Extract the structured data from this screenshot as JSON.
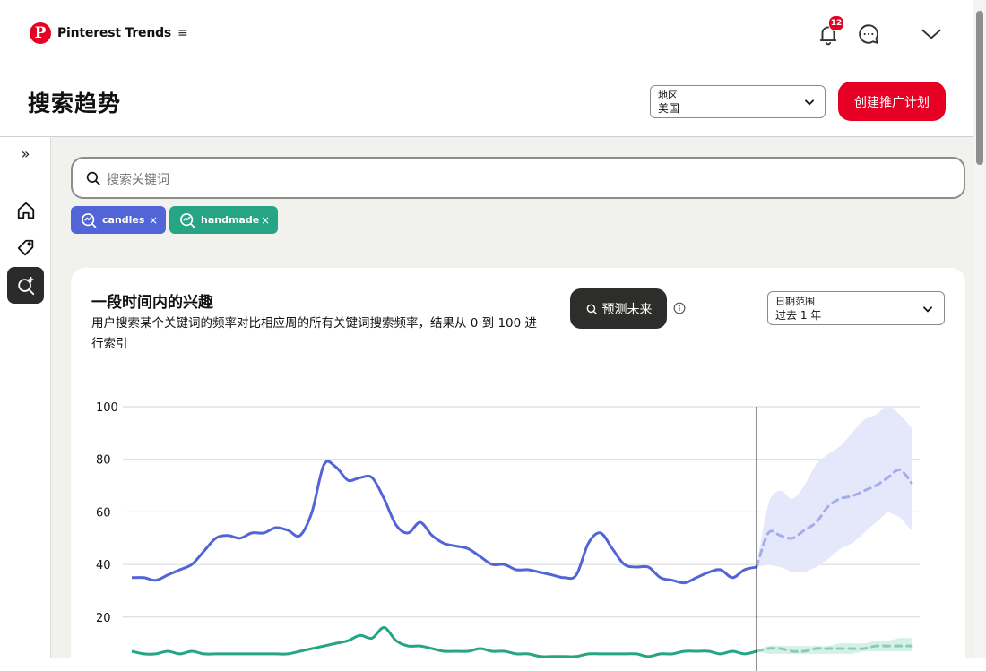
{
  "app": {
    "brand_name": "Pinterest Trends",
    "brand_letter": "P",
    "menu_glyph": "≡",
    "notifications_count": "12"
  },
  "colors": {
    "brand": "#e60023",
    "candles": "#5265d6",
    "handmade": "#26a585",
    "forecast_band": "#e4e7fb"
  },
  "icons": {
    "bell": "bell-icon",
    "chat": "chat-bubble-icon",
    "chevron": "chevron-down-icon",
    "home": "home-icon",
    "tag": "tag-icon",
    "trends": "trend-search-icon"
  },
  "header": {
    "title": "搜索趋势",
    "region_label": "地区",
    "region_value": "美国",
    "create_button": "创建推广计划"
  },
  "sidebar": {
    "expand_glyph": "»"
  },
  "search": {
    "placeholder": "搜索关键词"
  },
  "chips": [
    {
      "label": "candles",
      "remove": "×"
    },
    {
      "label": "handmade",
      "remove": "×"
    }
  ],
  "card": {
    "title": "一段时间内的兴趣",
    "subtitle": "用户搜索某个关键词的频率对比相应周的所有关键词搜索频率，结果从 0 到 100 进行索引",
    "forecast_button": "预测未来",
    "date_label": "日期范围",
    "date_value": "过去 1 年"
  },
  "chart_data": {
    "type": "line",
    "ylim": [
      0,
      100
    ],
    "yticks": [
      20,
      40,
      60,
      80,
      100
    ],
    "grid": true,
    "series": [
      {
        "name": "candles",
        "color": "#5265d6",
        "values": [
          35,
          35,
          34,
          36,
          38,
          40,
          45,
          50,
          51,
          50,
          52,
          52,
          54,
          53,
          51,
          60,
          78,
          77,
          72,
          73,
          73,
          65,
          55,
          52,
          56,
          51,
          48,
          47,
          46,
          43,
          40,
          40,
          38,
          38,
          37,
          36,
          35,
          36,
          48,
          52,
          46,
          40,
          39,
          39,
          35,
          34,
          33,
          35,
          37,
          38,
          35,
          38,
          39
        ],
        "forecast": [
          52,
          51,
          50,
          53,
          56,
          62,
          65,
          66,
          68,
          70,
          73,
          76,
          71
        ],
        "forecast_upper": [
          63,
          68,
          65,
          70,
          78,
          82,
          85,
          90,
          95,
          97,
          100,
          97,
          92
        ],
        "forecast_lower": [
          40,
          39,
          37,
          37,
          39,
          42,
          46,
          48,
          52,
          56,
          60,
          58,
          53
        ]
      },
      {
        "name": "handmade",
        "color": "#26a585",
        "values": [
          7,
          6,
          6,
          7,
          6,
          7,
          6,
          6,
          6,
          6,
          6,
          6,
          6,
          6,
          7,
          8,
          9,
          10,
          11,
          13,
          12,
          16,
          11,
          9,
          9,
          8,
          7,
          7,
          7,
          8,
          7,
          7,
          6,
          6,
          5,
          5,
          5,
          5,
          6,
          6,
          6,
          6,
          6,
          5,
          6,
          6,
          7,
          7,
          7,
          6,
          7,
          6,
          7
        ],
        "forecast": [
          8,
          8,
          7,
          7,
          8,
          8,
          8,
          8,
          8,
          9,
          9,
          9,
          9
        ],
        "forecast_upper": [
          9,
          9,
          9,
          9,
          9,
          9,
          10,
          10,
          10,
          11,
          11,
          12,
          12
        ],
        "forecast_lower": [
          6,
          6,
          6,
          6,
          6,
          6,
          6,
          6,
          7,
          7,
          7,
          7,
          7
        ]
      }
    ]
  }
}
